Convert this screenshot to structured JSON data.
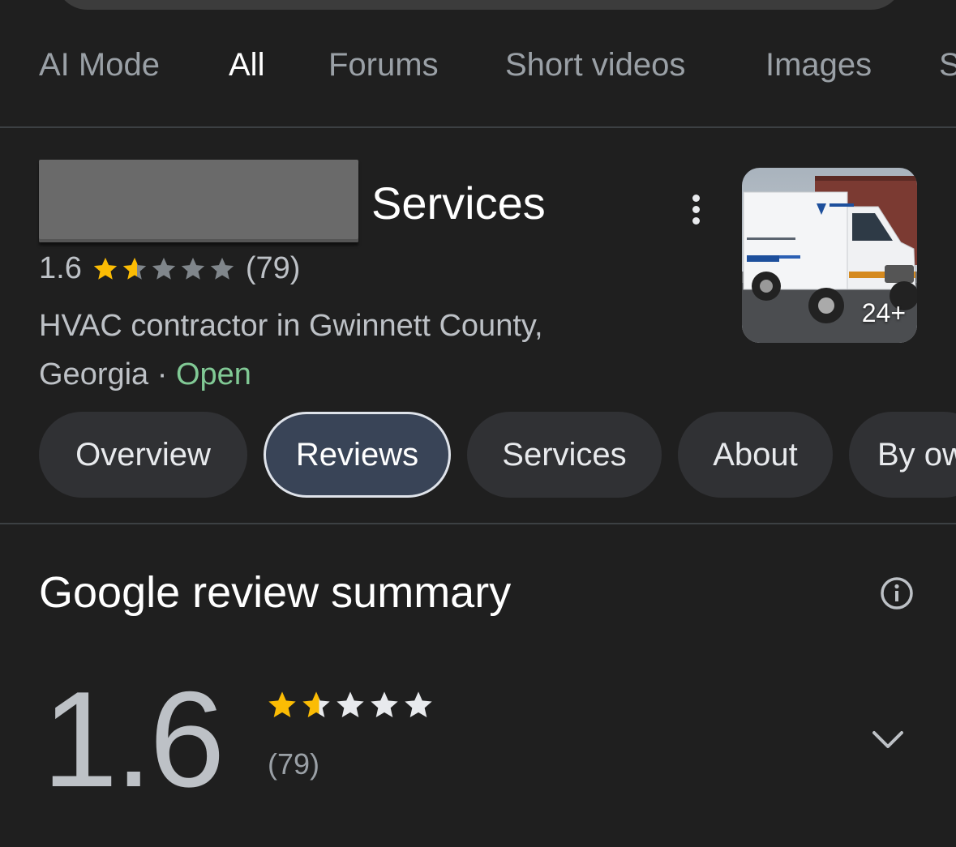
{
  "tabs": [
    {
      "label": "AI Mode"
    },
    {
      "label": "All"
    },
    {
      "label": "Forums"
    },
    {
      "label": "Short videos"
    },
    {
      "label": "Images"
    },
    {
      "label": "S"
    }
  ],
  "active_tab": "All",
  "business": {
    "name_suffix": "Services",
    "rating": "1.6",
    "stars_filled": 1.6,
    "stars_total": 5,
    "review_count": "(79)",
    "category": "HVAC contractor in Gwinnett County, Georgia",
    "separator": "·",
    "status": "Open",
    "photo_count": "24+"
  },
  "chips": [
    {
      "label": "Overview"
    },
    {
      "label": "Reviews"
    },
    {
      "label": "Services"
    },
    {
      "label": "About"
    },
    {
      "label": "By ow"
    }
  ],
  "selected_chip": "Reviews",
  "summary": {
    "title": "Google review summary",
    "rating": "1.6",
    "stars_filled": 1.6,
    "review_count": "(79)"
  },
  "icons": {
    "more": "kebab-menu-icon",
    "info": "info-icon",
    "expand": "chevron-down-icon"
  },
  "colors": {
    "background": "#1f1f1f",
    "star_filled": "#fbbc04",
    "star_empty_header": "#80868b",
    "star_empty_summary": "#e8eaed",
    "open": "#81c995",
    "chip": "#303134",
    "chip_selected": "#394457"
  }
}
